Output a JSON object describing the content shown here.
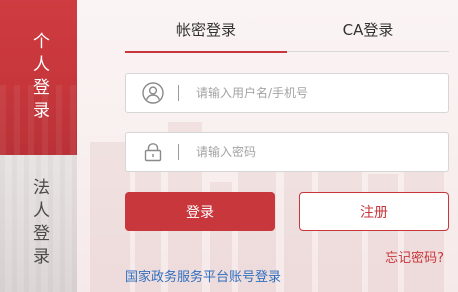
{
  "side_tabs": [
    {
      "label": "个人登录",
      "active": true
    },
    {
      "label": "法人登录",
      "active": false
    }
  ],
  "top_tabs": [
    {
      "label": "帐密登录",
      "active": true
    },
    {
      "label": "CA登录",
      "active": false
    }
  ],
  "form": {
    "username_placeholder": "请输入用户名/手机号",
    "password_placeholder": "请输入密码",
    "login_label": "登录",
    "register_label": "注册",
    "forgot_label": "忘记密码?",
    "gov_link_label": "国家政务服务平台账号登录"
  },
  "colors": {
    "accent": "#c8373c",
    "link": "#2f6fbf"
  },
  "icons": {
    "user": "user-circle-icon",
    "password": "lock-icon"
  }
}
